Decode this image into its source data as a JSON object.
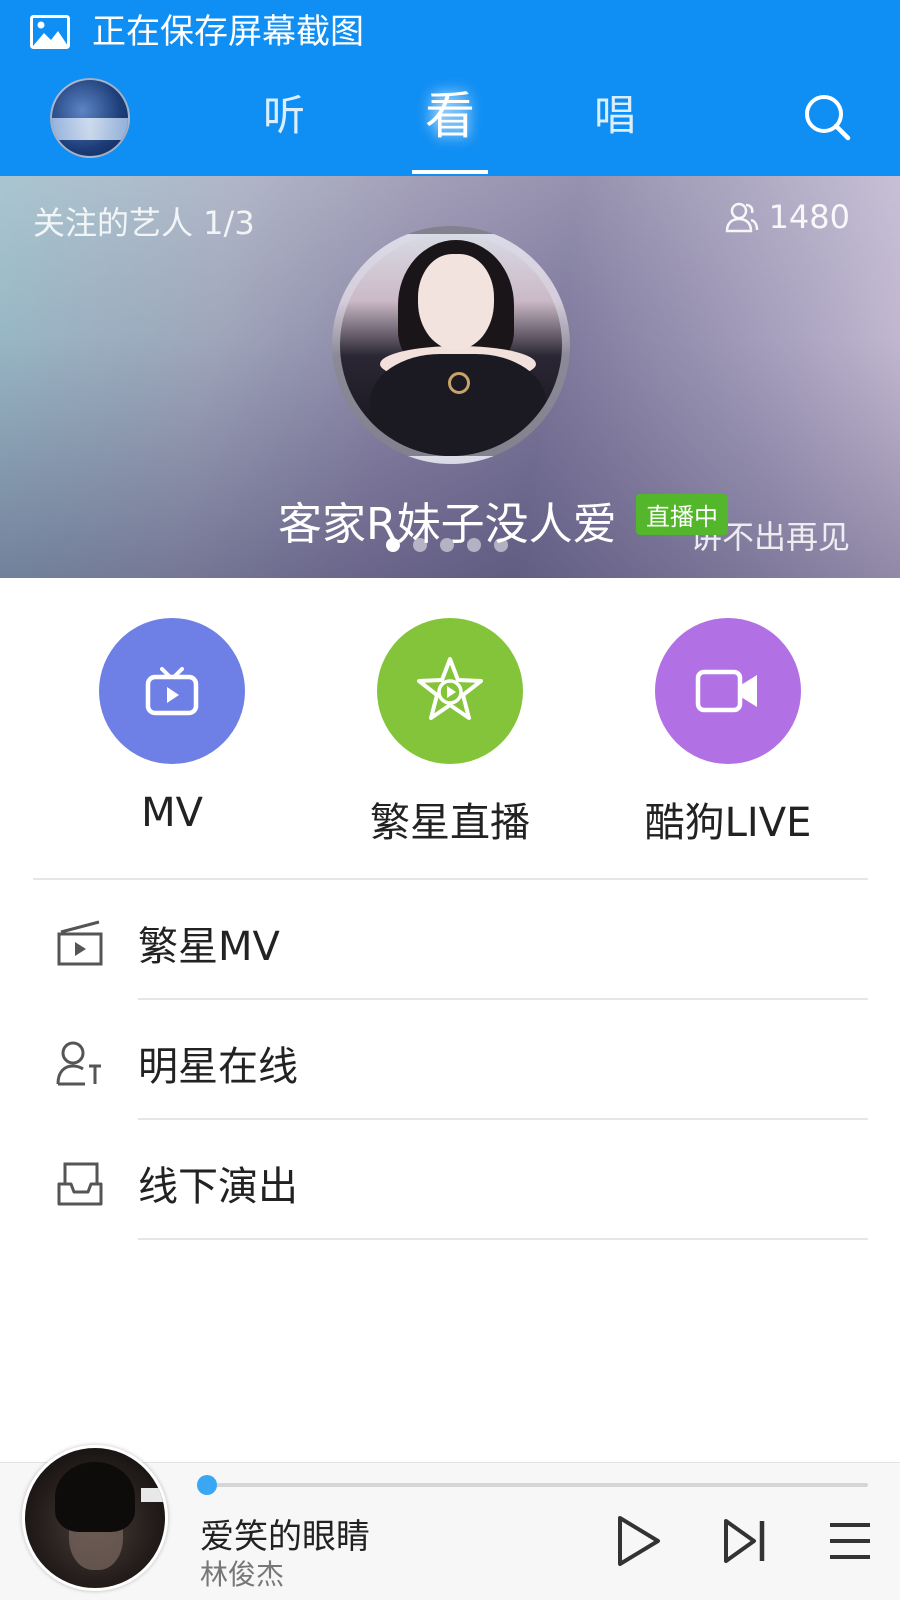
{
  "status_bar": {
    "icon": "image-icon",
    "text": "正在保存屏幕截图"
  },
  "nav": {
    "tabs": [
      {
        "label": "听",
        "active": false
      },
      {
        "label": "看",
        "active": true
      },
      {
        "label": "唱",
        "active": false
      }
    ],
    "search_icon": "search-icon"
  },
  "banner": {
    "follow_label": "关注的艺人 1/3",
    "fans_count": "1480",
    "fans_icon": "people-icon",
    "artist_name": "客家R妹子没人爱",
    "live_badge": "直播中",
    "song_text": "讲不出再见",
    "dots_total": 5,
    "dots_active": 1
  },
  "categories": [
    {
      "label": "MV",
      "icon": "tv-icon",
      "color": "#6e7fe6"
    },
    {
      "label": "繁星直播",
      "icon": "star-play-icon",
      "color": "#84c43a"
    },
    {
      "label": "酷狗LIVE",
      "icon": "video-camera-icon",
      "color": "#b170e3"
    }
  ],
  "list": [
    {
      "label": "繁星MV",
      "icon": "mv-box-icon"
    },
    {
      "label": "明星在线",
      "icon": "star-online-icon"
    },
    {
      "label": "线下演出",
      "icon": "inbox-icon"
    }
  ],
  "player": {
    "title": "爱笑的眼睛",
    "artist": "林俊杰",
    "progress": 0.01,
    "controls": [
      "play-icon",
      "next-icon",
      "playlist-icon"
    ]
  },
  "colors": {
    "primary": "#0f8ef3",
    "live_green": "#53b62b",
    "progress": "#3aa7f2"
  }
}
